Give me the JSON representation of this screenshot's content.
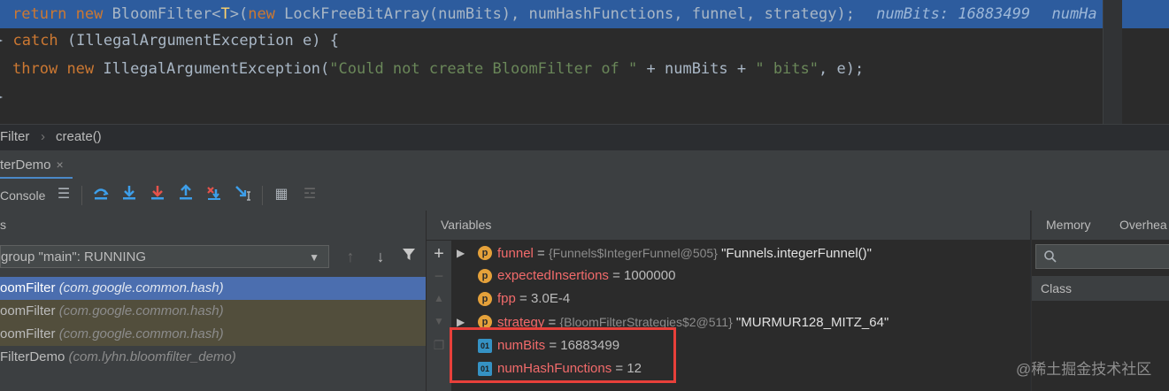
{
  "editor": {
    "line1": {
      "kw_return": "return",
      "kw_new": "new",
      "type": "BloomFilter<",
      "cursor": "T",
      "rest1": ">(",
      "kw_new2": "new",
      "call": "LockFreeBitArray(numBits), numHashFunctions, funnel, strategy);",
      "hint1": "numBits: 16883499",
      "hint2": "numHa"
    },
    "line2": {
      "brace": "} ",
      "kw_catch": "catch",
      "rest": " (IllegalArgumentException e) {"
    },
    "line3": {
      "kw_throw": "throw",
      "kw_new": "new",
      "ctor": "IllegalArgumentException(",
      "str1": "\"Could not create BloomFilter of \"",
      "mid": " + numBits + ",
      "str2": "\" bits\"",
      "end": ", e);"
    },
    "line4": {
      "brace": "}"
    }
  },
  "breadcrumb": {
    "class": "Filter",
    "sep": "›",
    "method": "create()"
  },
  "debug_tab": {
    "label": "terDemo",
    "close": "×"
  },
  "toolbar": {
    "console_label": "Console"
  },
  "frames": {
    "header": "s",
    "thread": "group \"main\": RUNNING",
    "items": [
      {
        "method": "oomFilter",
        "pkg": "(com.google.common.hash)"
      },
      {
        "method": "oomFilter",
        "pkg": "(com.google.common.hash)"
      },
      {
        "method": "oomFilter",
        "pkg": "(com.google.common.hash)"
      },
      {
        "method": "FilterDemo",
        "pkg": "(com.lyhn.bloomfilter_demo)"
      }
    ]
  },
  "variables": {
    "header": "Variables",
    "items": [
      {
        "icon": "p",
        "name": "funnel",
        "eq": " = ",
        "type": "{Funnels$IntegerFunnel@505}",
        "value": " \"Funnels.integerFunnel()\""
      },
      {
        "icon": "p",
        "name": "expectedInsertions",
        "eq": " = ",
        "value": "1000000"
      },
      {
        "icon": "p",
        "name": "fpp",
        "eq": " = ",
        "value": "3.0E-4"
      },
      {
        "icon": "p",
        "name": "strategy",
        "eq": " = ",
        "type": "{BloomFilterStrategies$2@511}",
        "value": " \"MURMUR128_MITZ_64\""
      },
      {
        "icon": "01",
        "name": "numBits",
        "eq": " = ",
        "value": "16883499"
      },
      {
        "icon": "01",
        "name": "numHashFunctions",
        "eq": " = ",
        "value": "12"
      }
    ]
  },
  "memory": {
    "tab_memory": "Memory",
    "tab_overhead": "Overhea",
    "class_header": "Class"
  },
  "watermark": "@稀土掘金技术社区",
  "colors": {
    "accent": "#4b6eaf",
    "highlight_box": "#e8403a",
    "keyword": "#cc7832",
    "string": "#6a8759"
  }
}
